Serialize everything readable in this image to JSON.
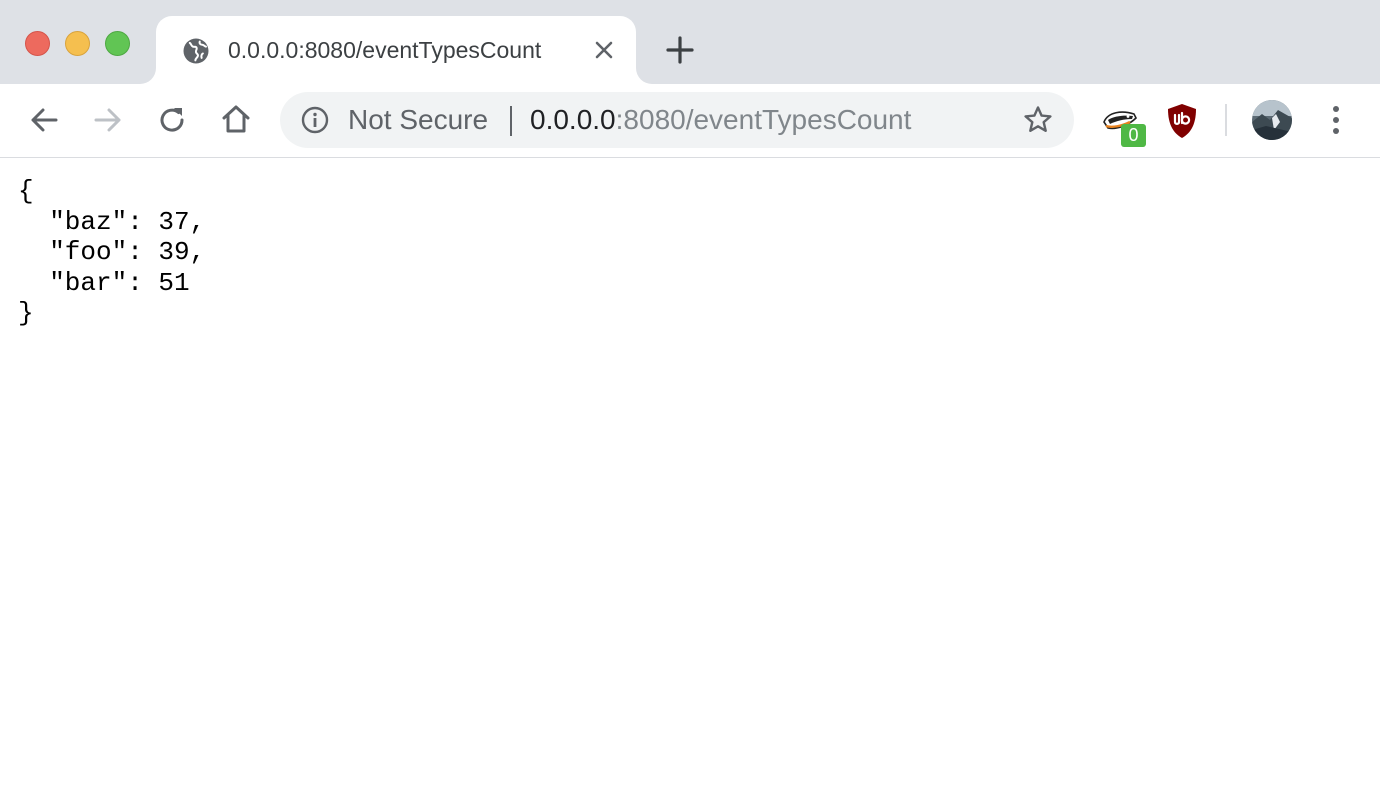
{
  "window": {
    "traffic_lights": [
      "close",
      "minimize",
      "maximize"
    ]
  },
  "tab": {
    "favicon": "globe-icon",
    "title": "0.0.0.0:8080/eventTypesCount",
    "close_icon": "close-icon"
  },
  "new_tab_icon": "plus-icon",
  "toolbar": {
    "back_icon": "arrow-left-icon",
    "forward_icon": "arrow-right-icon",
    "reload_icon": "reload-icon",
    "home_icon": "home-icon"
  },
  "omnibox": {
    "info_icon": "info-icon",
    "security_label": "Not Secure",
    "url_host": "0.0.0.0",
    "url_rest": ":8080/eventTypesCount",
    "bookmark_icon": "star-icon"
  },
  "extensions": {
    "privacy_badger": {
      "icon": "badger-icon",
      "badge": "0",
      "badge_color": "#4fb845"
    },
    "ublock": {
      "icon": "ublock-shield-icon",
      "label": "uo",
      "color": "#800000"
    }
  },
  "profile": {
    "icon": "avatar"
  },
  "menu_icon": "kebab-menu-icon",
  "page": {
    "json_text": "{\n  \"baz\": 37,\n  \"foo\": 39,\n  \"bar\": 51\n}"
  },
  "colors": {
    "tabstrip_bg": "#dee1e6",
    "omnibox_bg": "#f1f3f4",
    "icon_gray": "#5f6368",
    "url_dim": "#80868b"
  }
}
